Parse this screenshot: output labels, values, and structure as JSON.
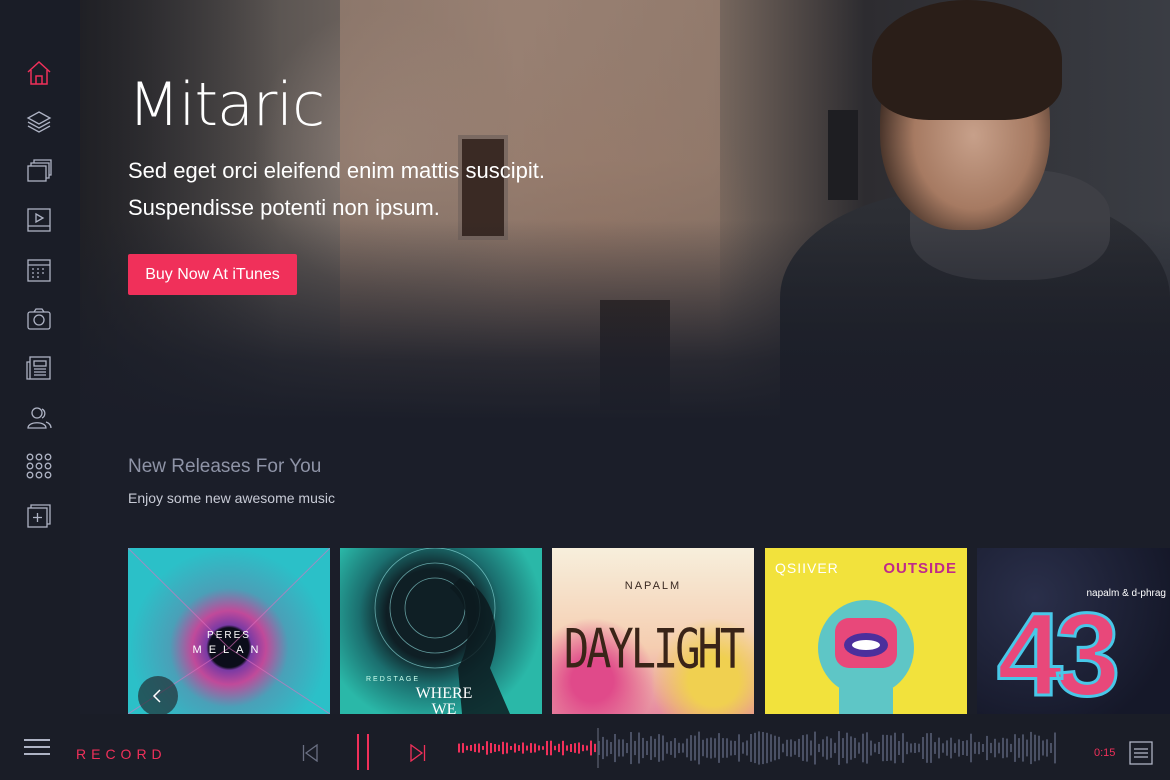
{
  "colors": {
    "accent": "#f0305a",
    "background": "#1b1e29",
    "sidebar": "#1a1d27",
    "muted_text": "#8e93a6"
  },
  "sidebar": {
    "items": [
      {
        "icon": "home-icon",
        "active": true
      },
      {
        "icon": "layers-icon",
        "active": false
      },
      {
        "icon": "gallery-icon",
        "active": false
      },
      {
        "icon": "video-icon",
        "active": false
      },
      {
        "icon": "calendar-icon",
        "active": false
      },
      {
        "icon": "camera-icon",
        "active": false
      },
      {
        "icon": "news-icon",
        "active": false
      },
      {
        "icon": "users-icon",
        "active": false
      },
      {
        "icon": "apps-grid-icon",
        "active": false
      },
      {
        "icon": "add-page-icon",
        "active": false
      }
    ]
  },
  "hero": {
    "title": "Mitaric",
    "subtitle_line1": "Sed eget orci eleifend enim mattis suscipit.",
    "subtitle_line2": "Suspendisse potenti non ipsum.",
    "button_label": "Buy Now At iTunes"
  },
  "releases": {
    "title": "New Releases For You",
    "subtitle": "Enjoy some new awesome music",
    "albums": [
      {
        "artist": "PERES",
        "title": "MELAN"
      },
      {
        "artist": "REDSTAGE",
        "title": "WHERE WE"
      },
      {
        "artist": "NAPALM",
        "title": "DAYLIGHT"
      },
      {
        "artist": "QSIIVER",
        "title": "OUTSIDE"
      },
      {
        "artist": "napalm & d-phrag",
        "title": "43"
      }
    ]
  },
  "player": {
    "label": "RECORD",
    "time": "0:15",
    "progress": 0.23,
    "state": "paused"
  }
}
